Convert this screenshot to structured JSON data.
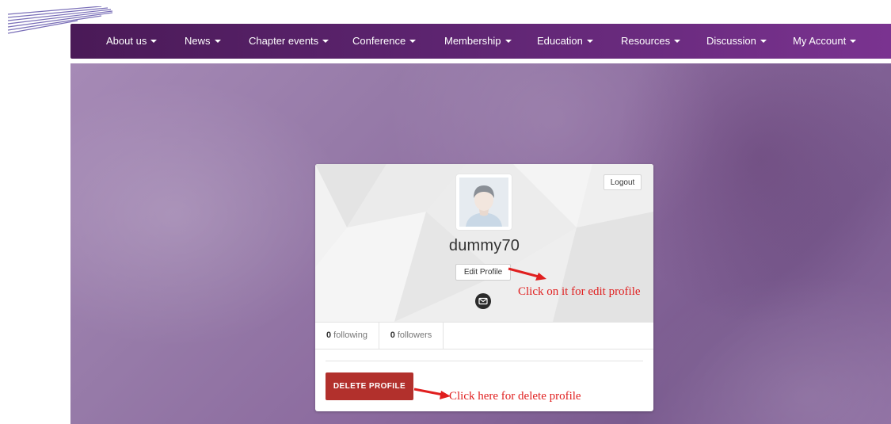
{
  "nav": {
    "items": [
      {
        "label": "About us"
      },
      {
        "label": "News"
      },
      {
        "label": "Chapter events"
      },
      {
        "label": "Conference"
      },
      {
        "label": "Membership"
      },
      {
        "label": "Education"
      },
      {
        "label": "Resources"
      },
      {
        "label": "Discussion"
      },
      {
        "label": "My Account"
      }
    ]
  },
  "profile": {
    "logout_label": "Logout",
    "username": "dummy70",
    "edit_label": "Edit Profile",
    "following_count": "0",
    "following_label": "following",
    "followers_count": "0",
    "followers_label": "followers",
    "delete_label": "DELETE PROFILE"
  },
  "annotations": {
    "edit_note": "Click on it for edit profile",
    "delete_note": "Click here for delete profile"
  },
  "colors": {
    "nav_start": "#4a1a57",
    "nav_end": "#7a3390",
    "delete_button": "#b2302c",
    "annotation": "#e01f1f"
  },
  "icons": {
    "site_logo": "diagonal-stripes-logo",
    "message": "envelope-icon",
    "avatar": "default-user-avatar"
  }
}
